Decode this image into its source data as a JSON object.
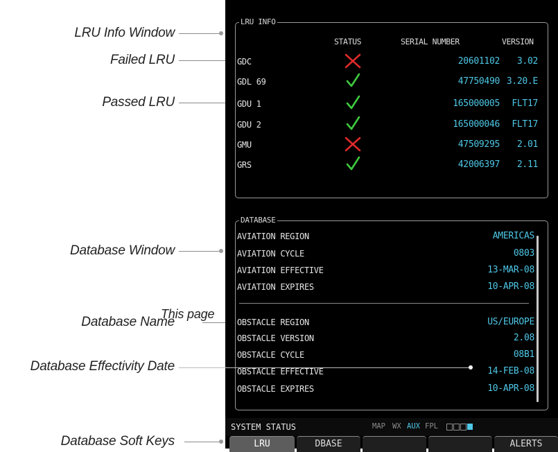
{
  "callouts": {
    "lru_info_window": "LRU Info Window",
    "failed_lru": "Failed LRU",
    "passed_lru": "Passed LRU",
    "database_window": "Database Window",
    "database_name": "Database Name",
    "this_page": "This page",
    "database_effectivity_date": "Database Effectivity Date",
    "database_soft_keys": "Database Soft Keys"
  },
  "lru_info": {
    "title": "LRU INFO",
    "headers": {
      "status": "STATUS",
      "serial": "SERIAL NUMBER",
      "version": "VERSION"
    },
    "rows": [
      {
        "name": "GDC",
        "status": "failed",
        "serial": "20601102",
        "version": "3.02"
      },
      {
        "name": "GDL 69",
        "status": "passed",
        "serial": "47750490",
        "version": "3.20.E"
      },
      {
        "name": "GDU 1",
        "status": "passed",
        "serial": "165000005",
        "version": "FLT17"
      },
      {
        "name": "GDU 2",
        "status": "passed",
        "serial": "165000046",
        "version": "FLT17"
      },
      {
        "name": "GMU",
        "status": "failed",
        "serial": "47509295",
        "version": "2.01"
      },
      {
        "name": "GRS",
        "status": "passed",
        "serial": "42006397",
        "version": "2.11"
      }
    ]
  },
  "database": {
    "title": "DATABASE",
    "aviation": [
      {
        "label": "AVIATION REGION",
        "value": "AMERICAS"
      },
      {
        "label": "AVIATION CYCLE",
        "value": "0803"
      },
      {
        "label": "AVIATION EFFECTIVE",
        "value": "13-MAR-08"
      },
      {
        "label": "AVIATION EXPIRES",
        "value": "10-APR-08"
      }
    ],
    "obstacle": [
      {
        "label": "OBSTACLE REGION",
        "value": "US/EUROPE"
      },
      {
        "label": "OBSTACLE VERSION",
        "value": "2.08"
      },
      {
        "label": "OBSTACLE CYCLE",
        "value": "08B1"
      },
      {
        "label": "OBSTACLE EFFECTIVE",
        "value": "14-FEB-08"
      },
      {
        "label": "OBSTACLE EXPIRES",
        "value": "10-APR-08"
      }
    ]
  },
  "status_bar": {
    "page_name": "SYSTEM STATUS",
    "page_groups": [
      {
        "label": "MAP",
        "active": false
      },
      {
        "label": "WX",
        "active": false
      },
      {
        "label": "AUX",
        "active": true
      },
      {
        "label": "FPL",
        "active": false
      }
    ]
  },
  "softkeys": [
    "LRU",
    "DBASE",
    "",
    "",
    "ALERTS"
  ],
  "active_softkey": "LRU",
  "colors": {
    "cyan": "#4ec7e6",
    "fail": "#e02a2a",
    "pass": "#3fc93f"
  },
  "icons": {
    "failed": "red-x-icon",
    "passed": "green-check-icon"
  }
}
